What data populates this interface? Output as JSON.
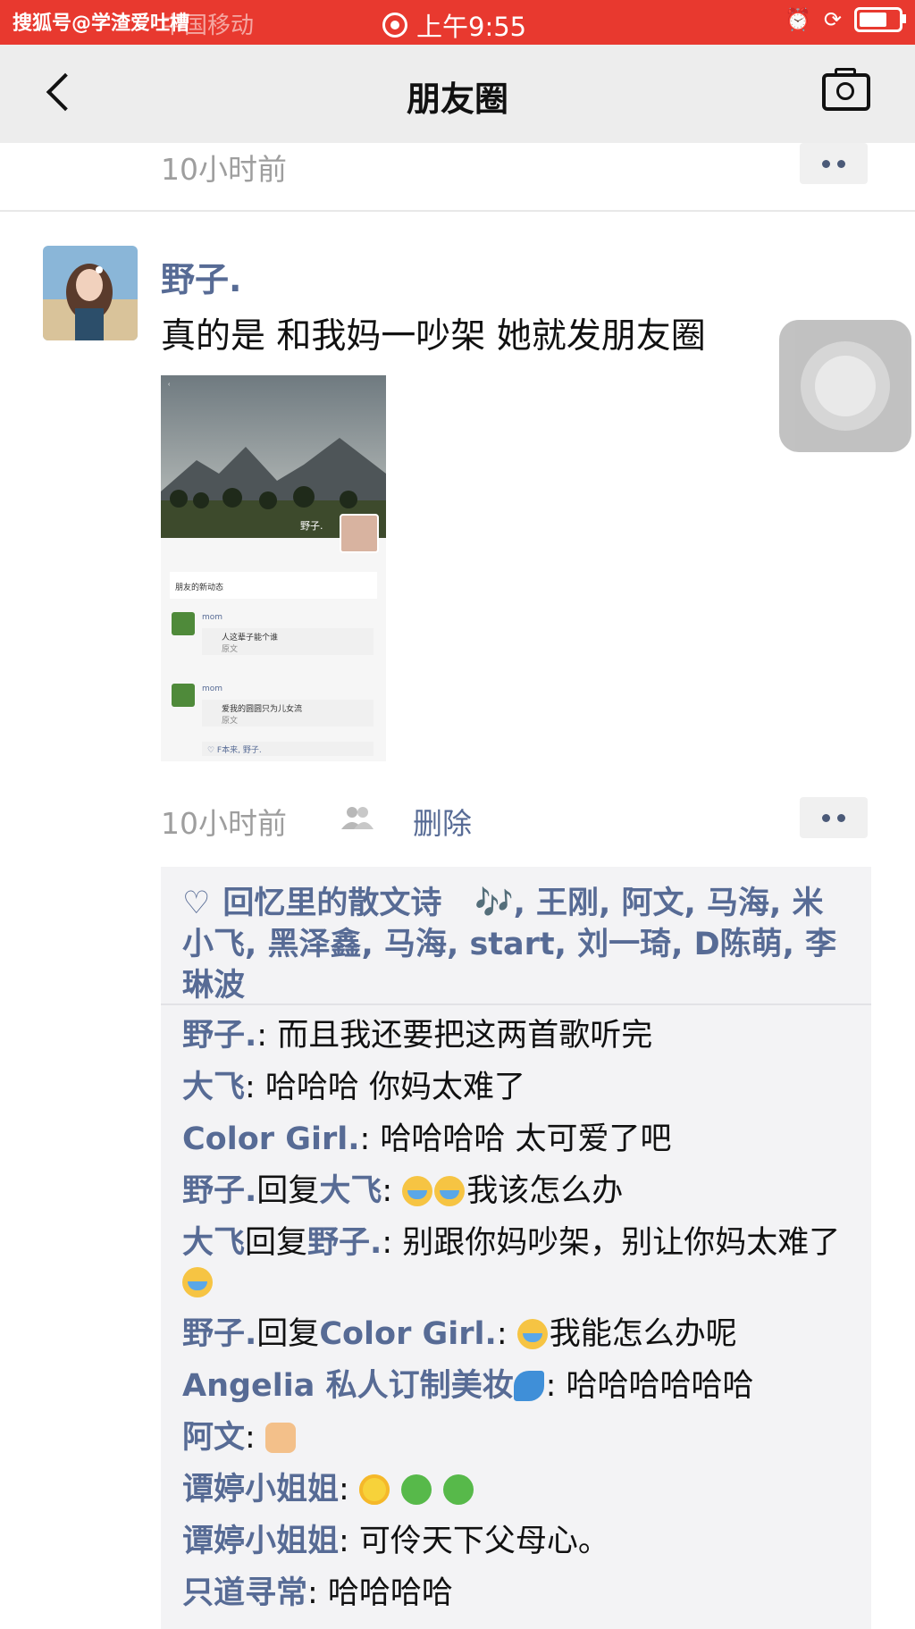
{
  "status_bar": {
    "watermark": "搜狐号@学渣爱吐槽",
    "carrier": "中国移动",
    "time": "上午9:55"
  },
  "nav": {
    "back_label": "",
    "title": "朋友圈"
  },
  "previous_post": {
    "time": "10小时前"
  },
  "post": {
    "username": "野子.",
    "text": "真的是 和我妈一吵架 她就发朋友圈",
    "embedded_screenshot": {
      "cover_name": "野子.",
      "header": "朋友的新动态",
      "item1_name": "mom",
      "item1_text": "人这辈子能个谁",
      "item1_sub": "原文",
      "item2_name": "mom",
      "item2_text": "爱我的圆圆只为儿女流",
      "item2_sub": "原文",
      "likes_line": "♡ F本来, 野子."
    },
    "time": "10小时前",
    "delete_label": "删除"
  },
  "likes": {
    "first": "回忆里的散文诗",
    "notes": "🎶",
    "rest": ", 王刚, 阿文, 马海, 米小飞, 黑泽鑫, 马海, start, 刘一琦, D陈萌, 李琳波"
  },
  "comments": [
    {
      "name": "野子.",
      "text": ": 而且我还要把这两首歌听完"
    },
    {
      "name": "大飞",
      "text": ": 哈哈哈 你妈太难了"
    },
    {
      "name": "Color Girl.",
      "text": ": 哈哈哈哈 太可爱了吧"
    },
    {
      "name": "野子.",
      "reply_word": "回复",
      "reply_to": "大飞",
      "text": "我该怎么办",
      "emoji_count": 2
    },
    {
      "name": "大飞",
      "reply_word": "回复",
      "reply_to": "野子.",
      "text": ": 别跟你妈吵架，别让你妈太难了"
    },
    {
      "name": "野子.",
      "reply_word": "回复",
      "reply_to": "Color Girl.",
      "text": "我能怎么办呢"
    },
    {
      "name": "Angelia 私人订制美妆",
      "text": ": 哈哈哈哈哈哈"
    },
    {
      "name": "阿文",
      "text": ":"
    },
    {
      "name": "谭婷小姐姐",
      "text": ":"
    },
    {
      "name": "谭婷小姐姐",
      "text": ": 可伶天下父母心。"
    },
    {
      "name": "只道寻常",
      "text": ": 哈哈哈哈"
    }
  ],
  "icons": {
    "back": "chevron-left-icon",
    "camera": "camera-icon",
    "more": "more-dots-icon",
    "people": "people-icon",
    "like": "heart-icon"
  },
  "colors": {
    "status_bar": "#e8392f",
    "link_blue": "#576b95",
    "comment_bg": "#f3f3f5"
  }
}
